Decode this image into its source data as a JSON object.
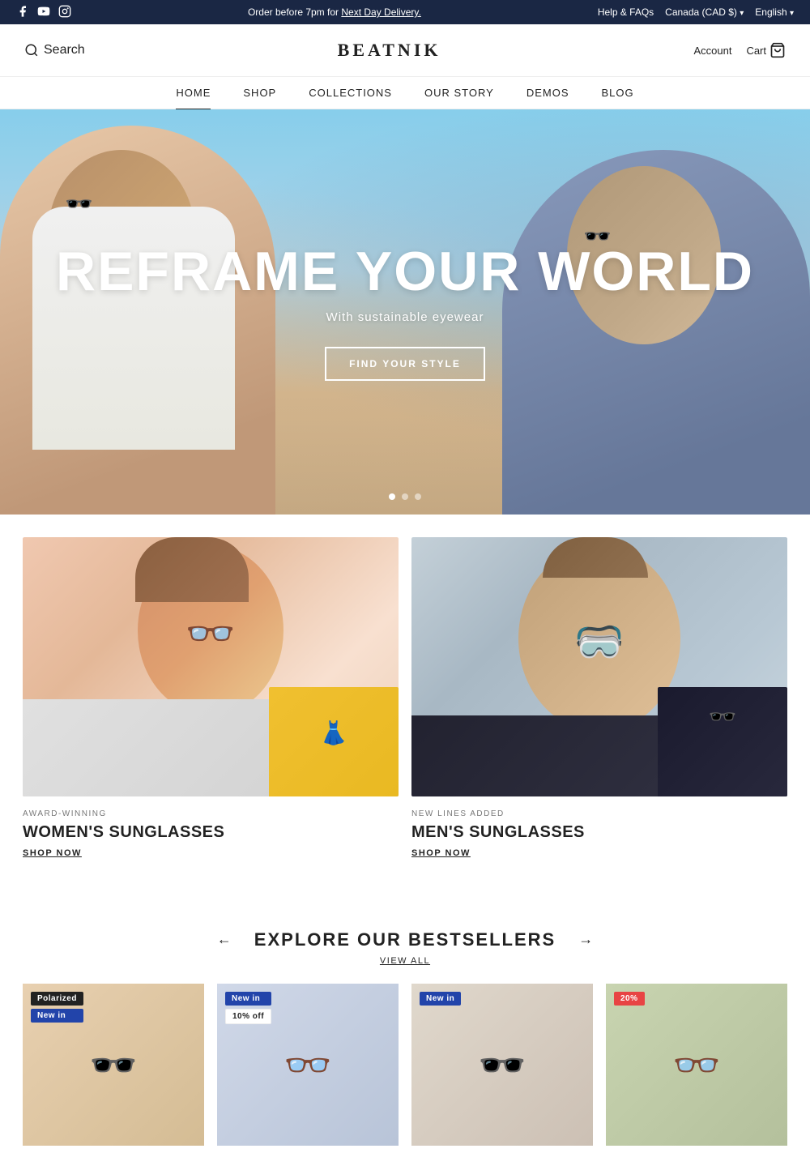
{
  "topbar": {
    "promo_text": "Order before 7pm for ",
    "promo_link": "Next Day Delivery.",
    "help_text": "Help & FAQs",
    "region_text": "Canada (CAD $)",
    "language_text": "English",
    "social_icons": [
      "facebook",
      "youtube",
      "instagram"
    ]
  },
  "header": {
    "search_label": "Search",
    "logo": "BEATNIK",
    "account_label": "Account",
    "cart_label": "Cart"
  },
  "nav": {
    "items": [
      {
        "label": "HOME",
        "active": true
      },
      {
        "label": "SHOP",
        "active": false
      },
      {
        "label": "COLLECTIONS",
        "active": false
      },
      {
        "label": "OUR STORY",
        "active": false
      },
      {
        "label": "DEMOS",
        "active": false
      },
      {
        "label": "BLOG",
        "active": false
      }
    ]
  },
  "hero": {
    "headline": "REFRAME YOUR WORLD",
    "subheading": "With sustainable eyewear",
    "cta_label": "FIND YOUR STYLE"
  },
  "categories": [
    {
      "id": "women",
      "badge": "AWARD-WINNING",
      "title": "WOMEN'S SUNGLASSES",
      "shop_label": "SHOP NOW"
    },
    {
      "id": "men",
      "badge": "NEW LINES ADDED",
      "title": "MEN'S SUNGLASSES",
      "shop_label": "SHOP NOW"
    }
  ],
  "bestsellers": {
    "title": "EXPLORE OUR BESTSELLERS",
    "view_all_label": "VIEW ALL",
    "products": [
      {
        "badges": [
          "Polarized",
          "New in"
        ],
        "badge_styles": [
          "dark",
          "blue"
        ]
      },
      {
        "badges": [
          "New in",
          "10% off"
        ],
        "badge_styles": [
          "blue",
          "discount"
        ]
      },
      {
        "badges": [
          "New in"
        ],
        "badge_styles": [
          "blue"
        ]
      },
      {
        "badges": [
          "20%"
        ],
        "badge_styles": [
          "orange"
        ]
      }
    ]
  }
}
